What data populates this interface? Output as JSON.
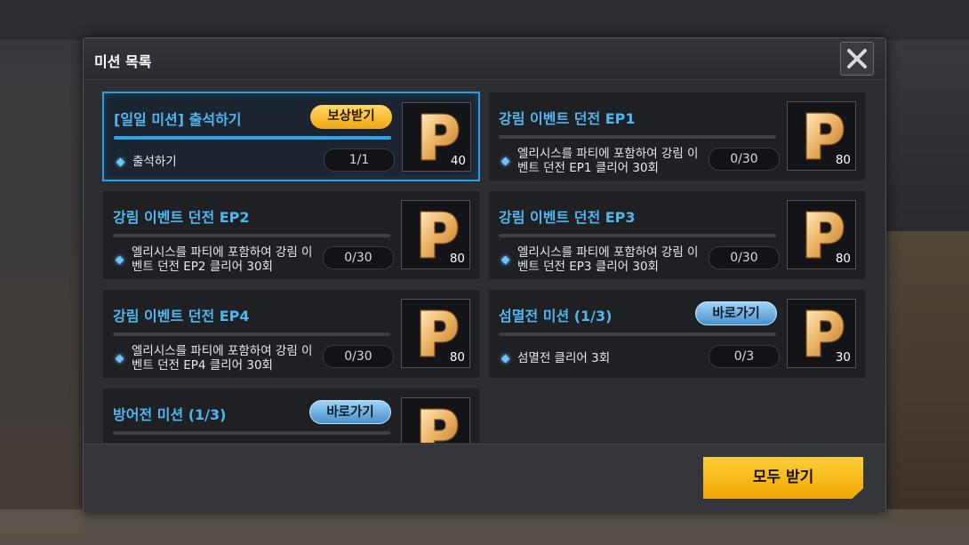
{
  "dialog": {
    "title": "미션 목록",
    "close_icon": "close-icon",
    "claim_all_label": "모두 받기"
  },
  "missions": [
    {
      "title": "[일일 미션] 출석하기",
      "desc": "출석하기",
      "progress": "1/1",
      "progress_fraction": 1.0,
      "action": "보상받기",
      "reward": "40"
    },
    {
      "title": "강림 이벤트 던전 EP1",
      "desc": "엘리시스를 파티에 포함하여 강림 이벤트 던전 EP1 클리어 30회",
      "progress": "0/30",
      "progress_fraction": 0,
      "action": "",
      "reward": "80"
    },
    {
      "title": "강림 이벤트 던전 EP2",
      "desc": "엘리시스를 파티에 포함하여 강림 이벤트 던전 EP2 클리어 30회",
      "progress": "0/30",
      "progress_fraction": 0,
      "action": "",
      "reward": "80"
    },
    {
      "title": "강림 이벤트 던전 EP3",
      "desc": "엘리시스를 파티에 포함하여 강림 이벤트 던전 EP3 클리어 30회",
      "progress": "0/30",
      "progress_fraction": 0,
      "action": "",
      "reward": "80"
    },
    {
      "title": "강림 이벤트 던전 EP4",
      "desc": "엘리시스를 파티에 포함하여 강림 이벤트 던전 EP4 클리어 30회",
      "progress": "0/30",
      "progress_fraction": 0,
      "action": "",
      "reward": "80"
    },
    {
      "title": "섬멸전 미션 (1/3)",
      "desc": "섬멸전 클리어 3회",
      "progress": "0/3",
      "progress_fraction": 0,
      "action": "바로가기",
      "reward": "30"
    },
    {
      "title": "방어전 미션 (1/3)",
      "desc": "",
      "progress": "",
      "progress_fraction": 0,
      "action": "바로가기",
      "reward": ""
    }
  ],
  "colors": {
    "title_blue": "#4fb6f0",
    "claim_gold": "#f1a80e",
    "go_blue": "#4a90c8",
    "active_border": "#2a9ee0"
  },
  "reward_icon": "p-coin-icon"
}
